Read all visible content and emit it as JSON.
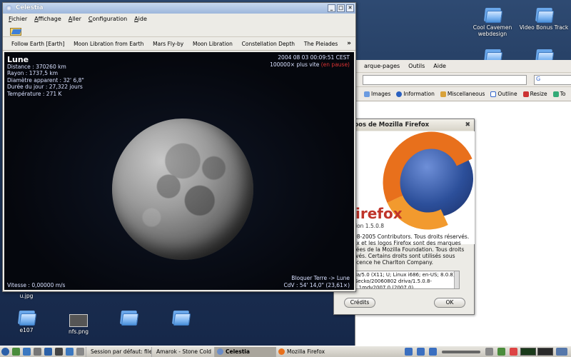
{
  "celestia": {
    "title": "Celestia",
    "menu": [
      "Fichier",
      "Affichage",
      "Aller",
      "Configuration",
      "Aide"
    ],
    "bookmarks": [
      "Follow Earth [Earth]",
      "Moon Libration from Earth",
      "Mars Fly-by",
      "Moon Libration",
      "Constellation Depth",
      "The Pleiades"
    ],
    "bookmarks_more": "»",
    "object": {
      "name": "Lune",
      "distance": "Distance : 370260 km",
      "radius": "Rayon : 1737,5 km",
      "apparent_diameter": "Diamètre apparent : 32' 6,8\"",
      "day_length": "Durée du jour : 27,322 jours",
      "temperature": "Température : 271 K"
    },
    "time": {
      "datetime": "2004 08 03 00:09:51 CEST",
      "speed": "100000× plus vite",
      "paused": "(en pause)"
    },
    "speed": "Vitesse : 0,00000 m/s",
    "lock": "Bloquer Terre -> Lune",
    "fov": "CdV : 54' 14,0\" (23,61×)"
  },
  "firefox": {
    "menu_partial": [
      "arque-pages",
      "Outils",
      "Aide"
    ],
    "bookmarks": [
      "Images",
      "Information",
      "Miscellaneous",
      "Outline",
      "Resize",
      "To"
    ],
    "search_placeholder": "G"
  },
  "about_dialog": {
    "title": "ropos de Mozilla Firefox",
    "brand": "irefox",
    "version": "ion 1.5.0.8",
    "copyright": "98-2005 Contributors. Tous droits réservés. ox et les logos Firefox sont des marques sées de la Mozilla Foundation. Tous droits rvés. Certains droits sont utilisés sous licence he Charlton Company.",
    "user_agent": "lla/5.0 (X11; U; Linux i686; en-US; 8.0.8) Gecko/20060802 driva/1.5.0.8-1.1mdv2007.0 (2007.0)",
    "credits": "Crédits",
    "ok": "OK"
  },
  "desktop_icons": {
    "cool_cavemen": "Cool Cavemen webdesign",
    "video_bonus": "Video Bonus Track",
    "u_jpg": "u.jpg",
    "e107": "e107",
    "nfs": "nfs.png"
  },
  "taskbar": {
    "tasks": [
      "Session par défaut: file",
      "Amarok - Stone Cold",
      "Celestia",
      "Mozilla Firefox"
    ]
  },
  "colors": {
    "firefox_orange": "#e8701c",
    "pause_red": "#dd3333",
    "titlebar_blue": "#9db7dc"
  }
}
